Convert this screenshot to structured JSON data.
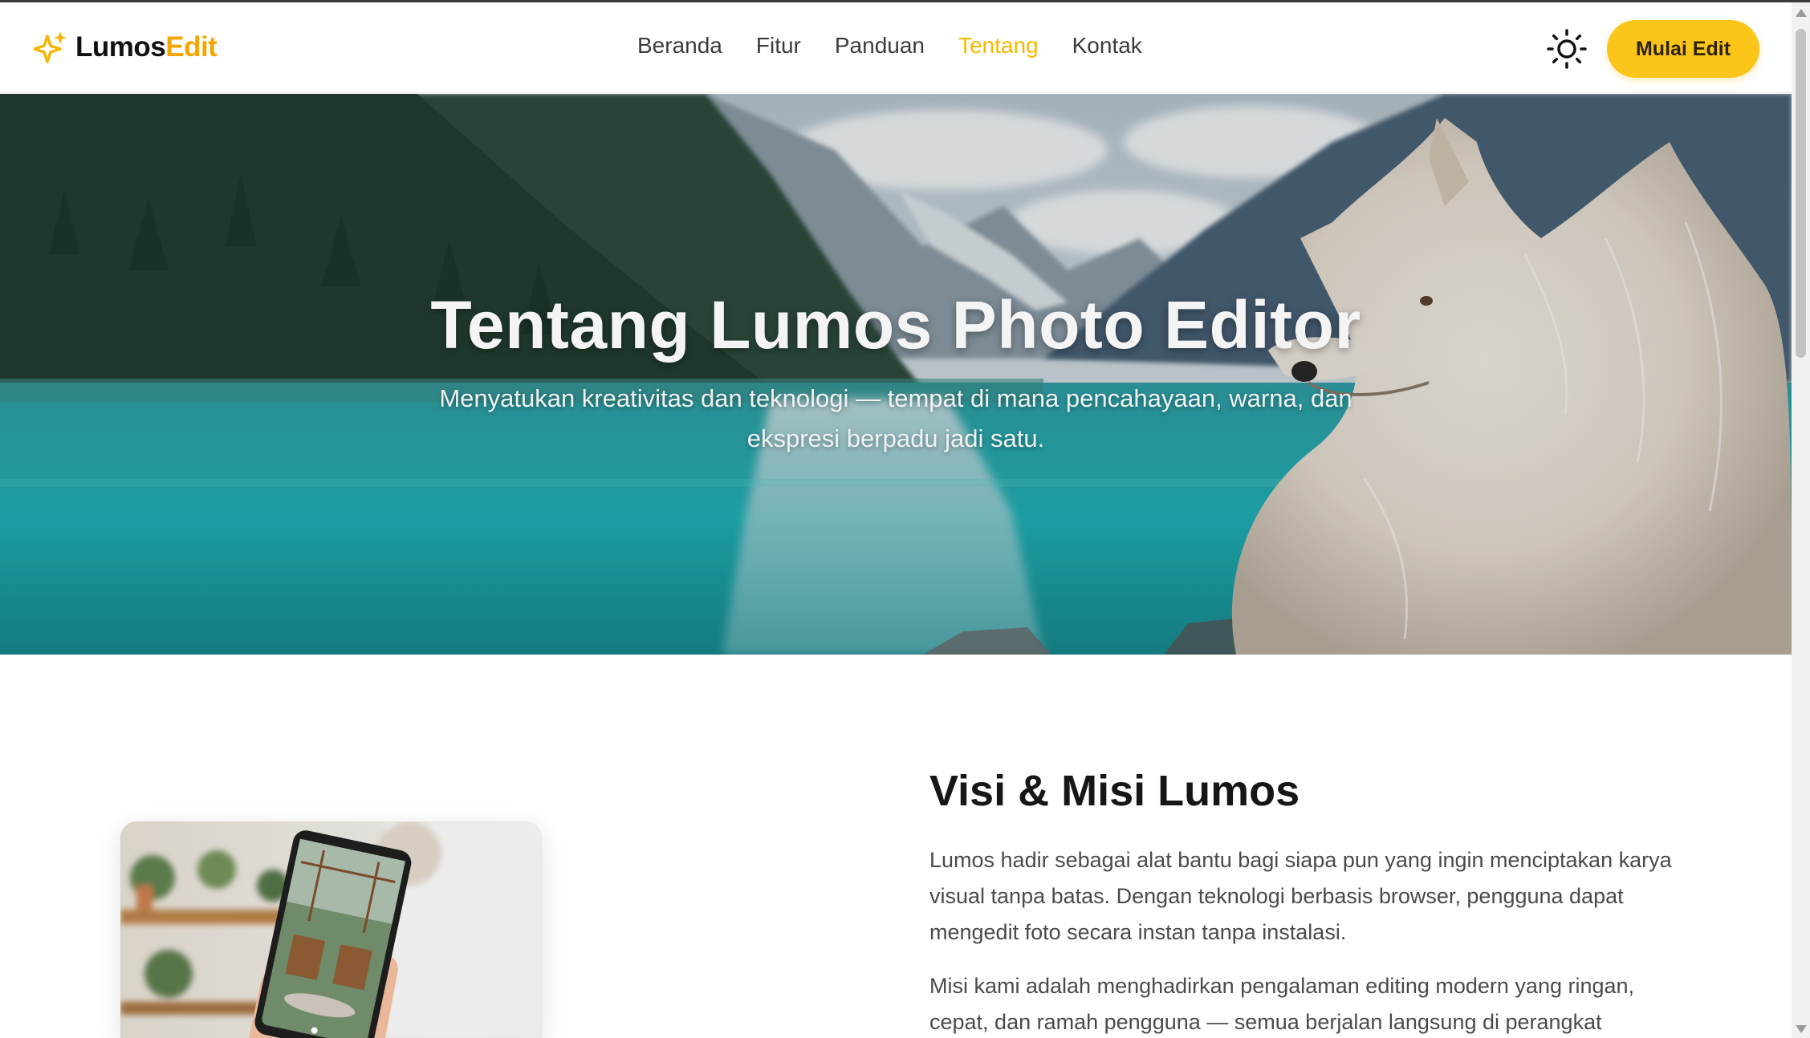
{
  "brand": {
    "name_part1": "Lumos",
    "name_part2": "Edit",
    "icon": "sparkle-icon"
  },
  "nav": {
    "items": [
      {
        "label": "Beranda",
        "active": false
      },
      {
        "label": "Fitur",
        "active": false
      },
      {
        "label": "Panduan",
        "active": false
      },
      {
        "label": "Tentang",
        "active": true
      },
      {
        "label": "Kontak",
        "active": false
      }
    ],
    "theme_toggle_icon": "sun-icon",
    "cta_label": "Mulai Edit"
  },
  "hero": {
    "title": "Tentang Lumos Photo Editor",
    "subtitle": "Menyatukan kreativitas dan teknologi — tempat di mana pencahayaan, warna, dan ekspresi berpadu jadi satu."
  },
  "about": {
    "title": "Visi & Misi Lumos",
    "paragraph1": "Lumos hadir sebagai alat bantu bagi siapa pun yang ingin menciptakan karya visual tanpa batas. Dengan teknologi berbasis browser, pengguna dapat mengedit foto secara instan tanpa instalasi.",
    "paragraph2": "Misi kami adalah menghadirkan pengalaman editing modern yang ringan, cepat, dan ramah pengguna — semua berjalan langsung di perangkat"
  },
  "colors": {
    "accent": "#fbc51a",
    "active_link": "#f6b700",
    "brand_secondary": "#f6a500"
  }
}
